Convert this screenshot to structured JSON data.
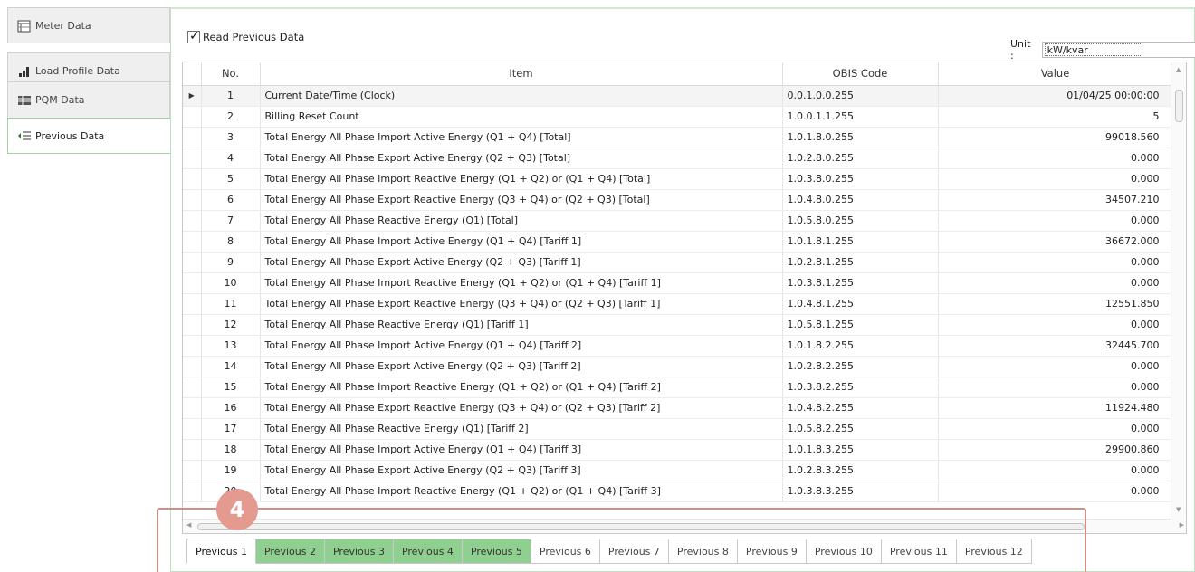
{
  "sidebar": {
    "items": [
      {
        "label": "Meter Data",
        "icon": "table-icon"
      },
      {
        "label": "Load Profile Data",
        "icon": "bar-chart-icon"
      },
      {
        "label": "PQM Data",
        "icon": "grid-icon"
      },
      {
        "label": "Previous Data",
        "icon": "list-arrow-icon"
      }
    ]
  },
  "options": {
    "read_previous_label": "Read Previous Data",
    "read_previous_checked": true,
    "unit_label": "Unit :",
    "unit_value": "kW/kvar"
  },
  "grid": {
    "columns": [
      "No.",
      "Item",
      "OBIS Code",
      "Value"
    ],
    "rows": [
      {
        "no": "1",
        "item": "Current Date/Time (Clock)",
        "obis": "0.0.1.0.0.255",
        "value": "01/04/25 00:00:00"
      },
      {
        "no": "2",
        "item": "Billing Reset Count",
        "obis": "1.0.0.1.1.255",
        "value": "5"
      },
      {
        "no": "3",
        "item": "Total Energy All Phase Import Active Energy (Q1 + Q4) [Total]",
        "obis": "1.0.1.8.0.255",
        "value": "99018.560"
      },
      {
        "no": "4",
        "item": "Total Energy All Phase Export Active Energy (Q2 + Q3) [Total]",
        "obis": "1.0.2.8.0.255",
        "value": "0.000"
      },
      {
        "no": "5",
        "item": "Total Energy All Phase Import Reactive Energy (Q1 + Q2) or (Q1 + Q4) [Total]",
        "obis": "1.0.3.8.0.255",
        "value": "0.000"
      },
      {
        "no": "6",
        "item": "Total Energy All Phase Export Reactive Energy (Q3 + Q4) or (Q2 + Q3) [Total]",
        "obis": "1.0.4.8.0.255",
        "value": "34507.210"
      },
      {
        "no": "7",
        "item": "Total Energy All Phase Reactive Energy (Q1) [Total]",
        "obis": "1.0.5.8.0.255",
        "value": "0.000"
      },
      {
        "no": "8",
        "item": "Total Energy All Phase Import Active Energy (Q1 + Q4) [Tariff 1]",
        "obis": "1.0.1.8.1.255",
        "value": "36672.000"
      },
      {
        "no": "9",
        "item": "Total Energy All Phase Export Active Energy (Q2 + Q3) [Tariff 1]",
        "obis": "1.0.2.8.1.255",
        "value": "0.000"
      },
      {
        "no": "10",
        "item": "Total Energy All Phase Import Reactive Energy (Q1 + Q2) or (Q1 + Q4) [Tariff 1]",
        "obis": "1.0.3.8.1.255",
        "value": "0.000"
      },
      {
        "no": "11",
        "item": "Total Energy All Phase Export Reactive Energy (Q3 + Q4) or (Q2 + Q3) [Tariff 1]",
        "obis": "1.0.4.8.1.255",
        "value": "12551.850"
      },
      {
        "no": "12",
        "item": "Total Energy All Phase Reactive Energy (Q1) [Tariff 1]",
        "obis": "1.0.5.8.1.255",
        "value": "0.000"
      },
      {
        "no": "13",
        "item": "Total Energy All Phase Import Active Energy (Q1 + Q4) [Tariff 2]",
        "obis": "1.0.1.8.2.255",
        "value": "32445.700"
      },
      {
        "no": "14",
        "item": "Total Energy All Phase Export Active Energy (Q2 + Q3) [Tariff 2]",
        "obis": "1.0.2.8.2.255",
        "value": "0.000"
      },
      {
        "no": "15",
        "item": "Total Energy All Phase Import Reactive Energy (Q1 + Q2) or (Q1 + Q4) [Tariff 2]",
        "obis": "1.0.3.8.2.255",
        "value": "0.000"
      },
      {
        "no": "16",
        "item": "Total Energy All Phase Export Reactive Energy (Q3 + Q4) or (Q2 + Q3) [Tariff 2]",
        "obis": "1.0.4.8.2.255",
        "value": "11924.480"
      },
      {
        "no": "17",
        "item": "Total Energy All Phase Reactive Energy (Q1) [Tariff 2]",
        "obis": "1.0.5.8.2.255",
        "value": "0.000"
      },
      {
        "no": "18",
        "item": "Total Energy All Phase Import Active Energy (Q1 + Q4) [Tariff 3]",
        "obis": "1.0.1.8.3.255",
        "value": "29900.860"
      },
      {
        "no": "19",
        "item": "Total Energy All Phase Export Active Energy (Q2 + Q3) [Tariff 3]",
        "obis": "1.0.2.8.3.255",
        "value": "0.000"
      },
      {
        "no": "20",
        "item": "Total Energy All Phase Import Reactive Energy (Q1 + Q2) or (Q1 + Q4) [Tariff 3]",
        "obis": "1.0.3.8.3.255",
        "value": "0.000"
      }
    ]
  },
  "tabs": [
    {
      "label": "Previous 1",
      "state": "active"
    },
    {
      "label": "Previous 2",
      "state": "green"
    },
    {
      "label": "Previous 3",
      "state": "green"
    },
    {
      "label": "Previous 4",
      "state": "green"
    },
    {
      "label": "Previous 5",
      "state": "green"
    },
    {
      "label": "Previous 6",
      "state": "normal"
    },
    {
      "label": "Previous 7",
      "state": "normal"
    },
    {
      "label": "Previous 8",
      "state": "normal"
    },
    {
      "label": "Previous 9",
      "state": "normal"
    },
    {
      "label": "Previous 10",
      "state": "normal"
    },
    {
      "label": "Previous 11",
      "state": "normal"
    },
    {
      "label": "Previous 12",
      "state": "normal"
    }
  ],
  "annotation": {
    "badge": "4"
  },
  "colors": {
    "tab_green": "#8fcf8f",
    "callout": "#e59a8f",
    "active_border": "#9fd39f"
  }
}
